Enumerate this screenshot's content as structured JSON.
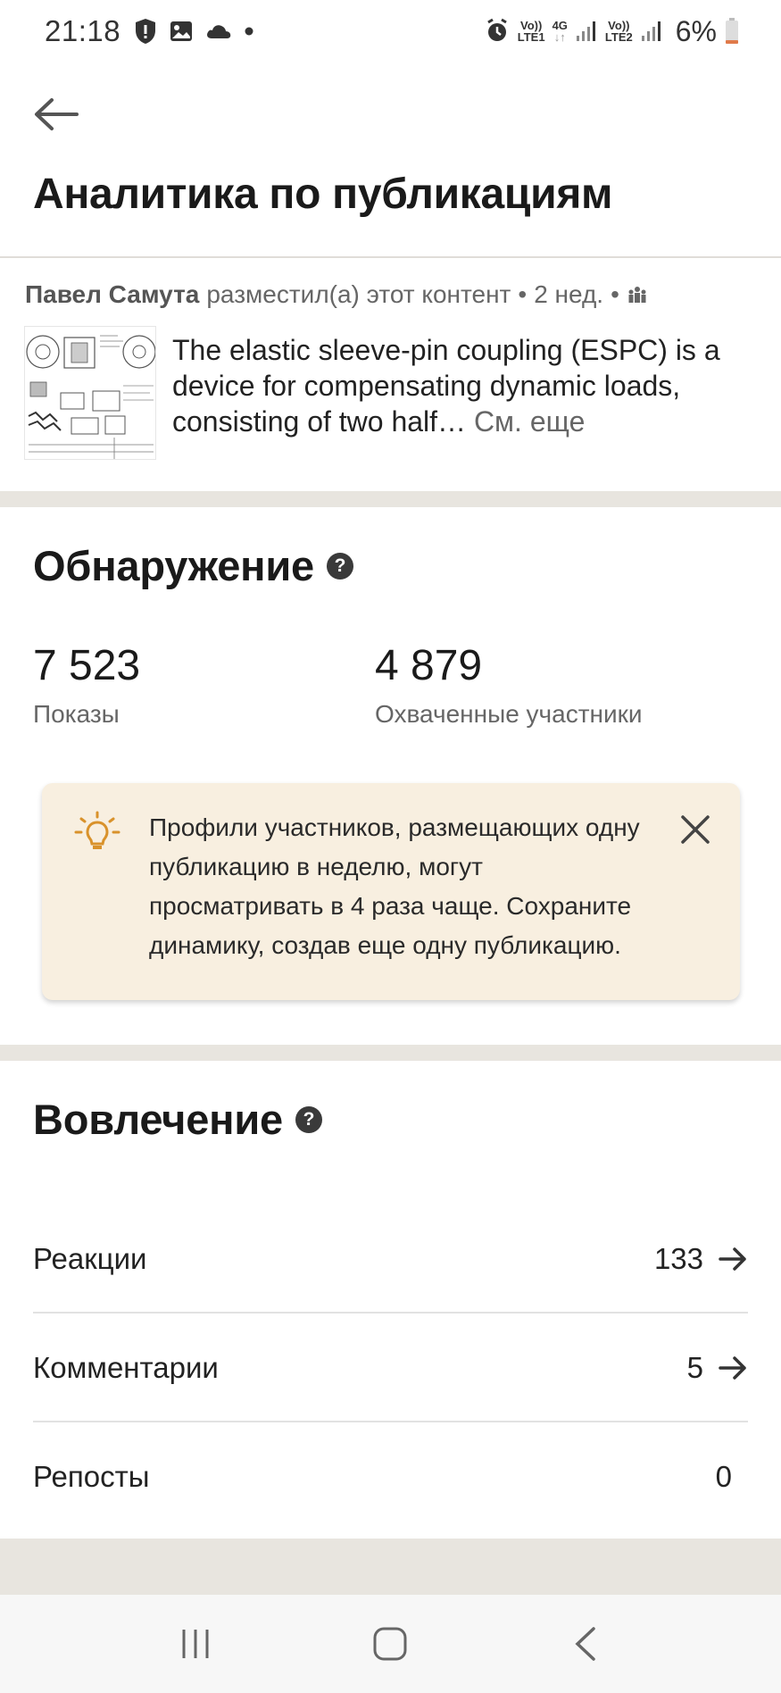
{
  "status_bar": {
    "time": "21:18",
    "sim1_top": "Vo))",
    "sim1_bottom": "LTE1",
    "net_type": "4G",
    "sim2_top": "Vo))",
    "sim2_bottom": "LTE2",
    "battery": "6%",
    "icons": [
      "shield-icon",
      "image-icon",
      "cloud-icon",
      "dot-icon",
      "alarm-icon",
      "signal-icon",
      "battery-icon"
    ]
  },
  "header": {
    "title": "Аналитика по публикациям"
  },
  "post": {
    "author": "Павел Самута",
    "action": "разместил(а) этот контент",
    "age": "2 нед.",
    "text": "The elastic sleeve-pin coupling (ESPC) is a device for compensating dynamic loads, consisting of two half…",
    "see_more": "См. еще"
  },
  "discovery": {
    "title": "Обнаружение",
    "impressions_value": "7 523",
    "impressions_label": "Показы",
    "reach_value": "4 879",
    "reach_label": "Охваченные участники",
    "tip_text": "Профили участников, размещающих одну публикацию в неделю, могут просматривать в 4 раза чаще. Сохраните динамику, создав еще одну публикацию."
  },
  "engagement": {
    "title": "Вовлечение",
    "rows": [
      {
        "label": "Реакции",
        "value": "133"
      },
      {
        "label": "Комментарии",
        "value": "5"
      },
      {
        "label": "Репосты",
        "value": "0"
      }
    ]
  },
  "colors": {
    "accent_tip_bg": "#f8efe0",
    "bulb": "#d9922b",
    "section_sep": "#e8e5df"
  }
}
